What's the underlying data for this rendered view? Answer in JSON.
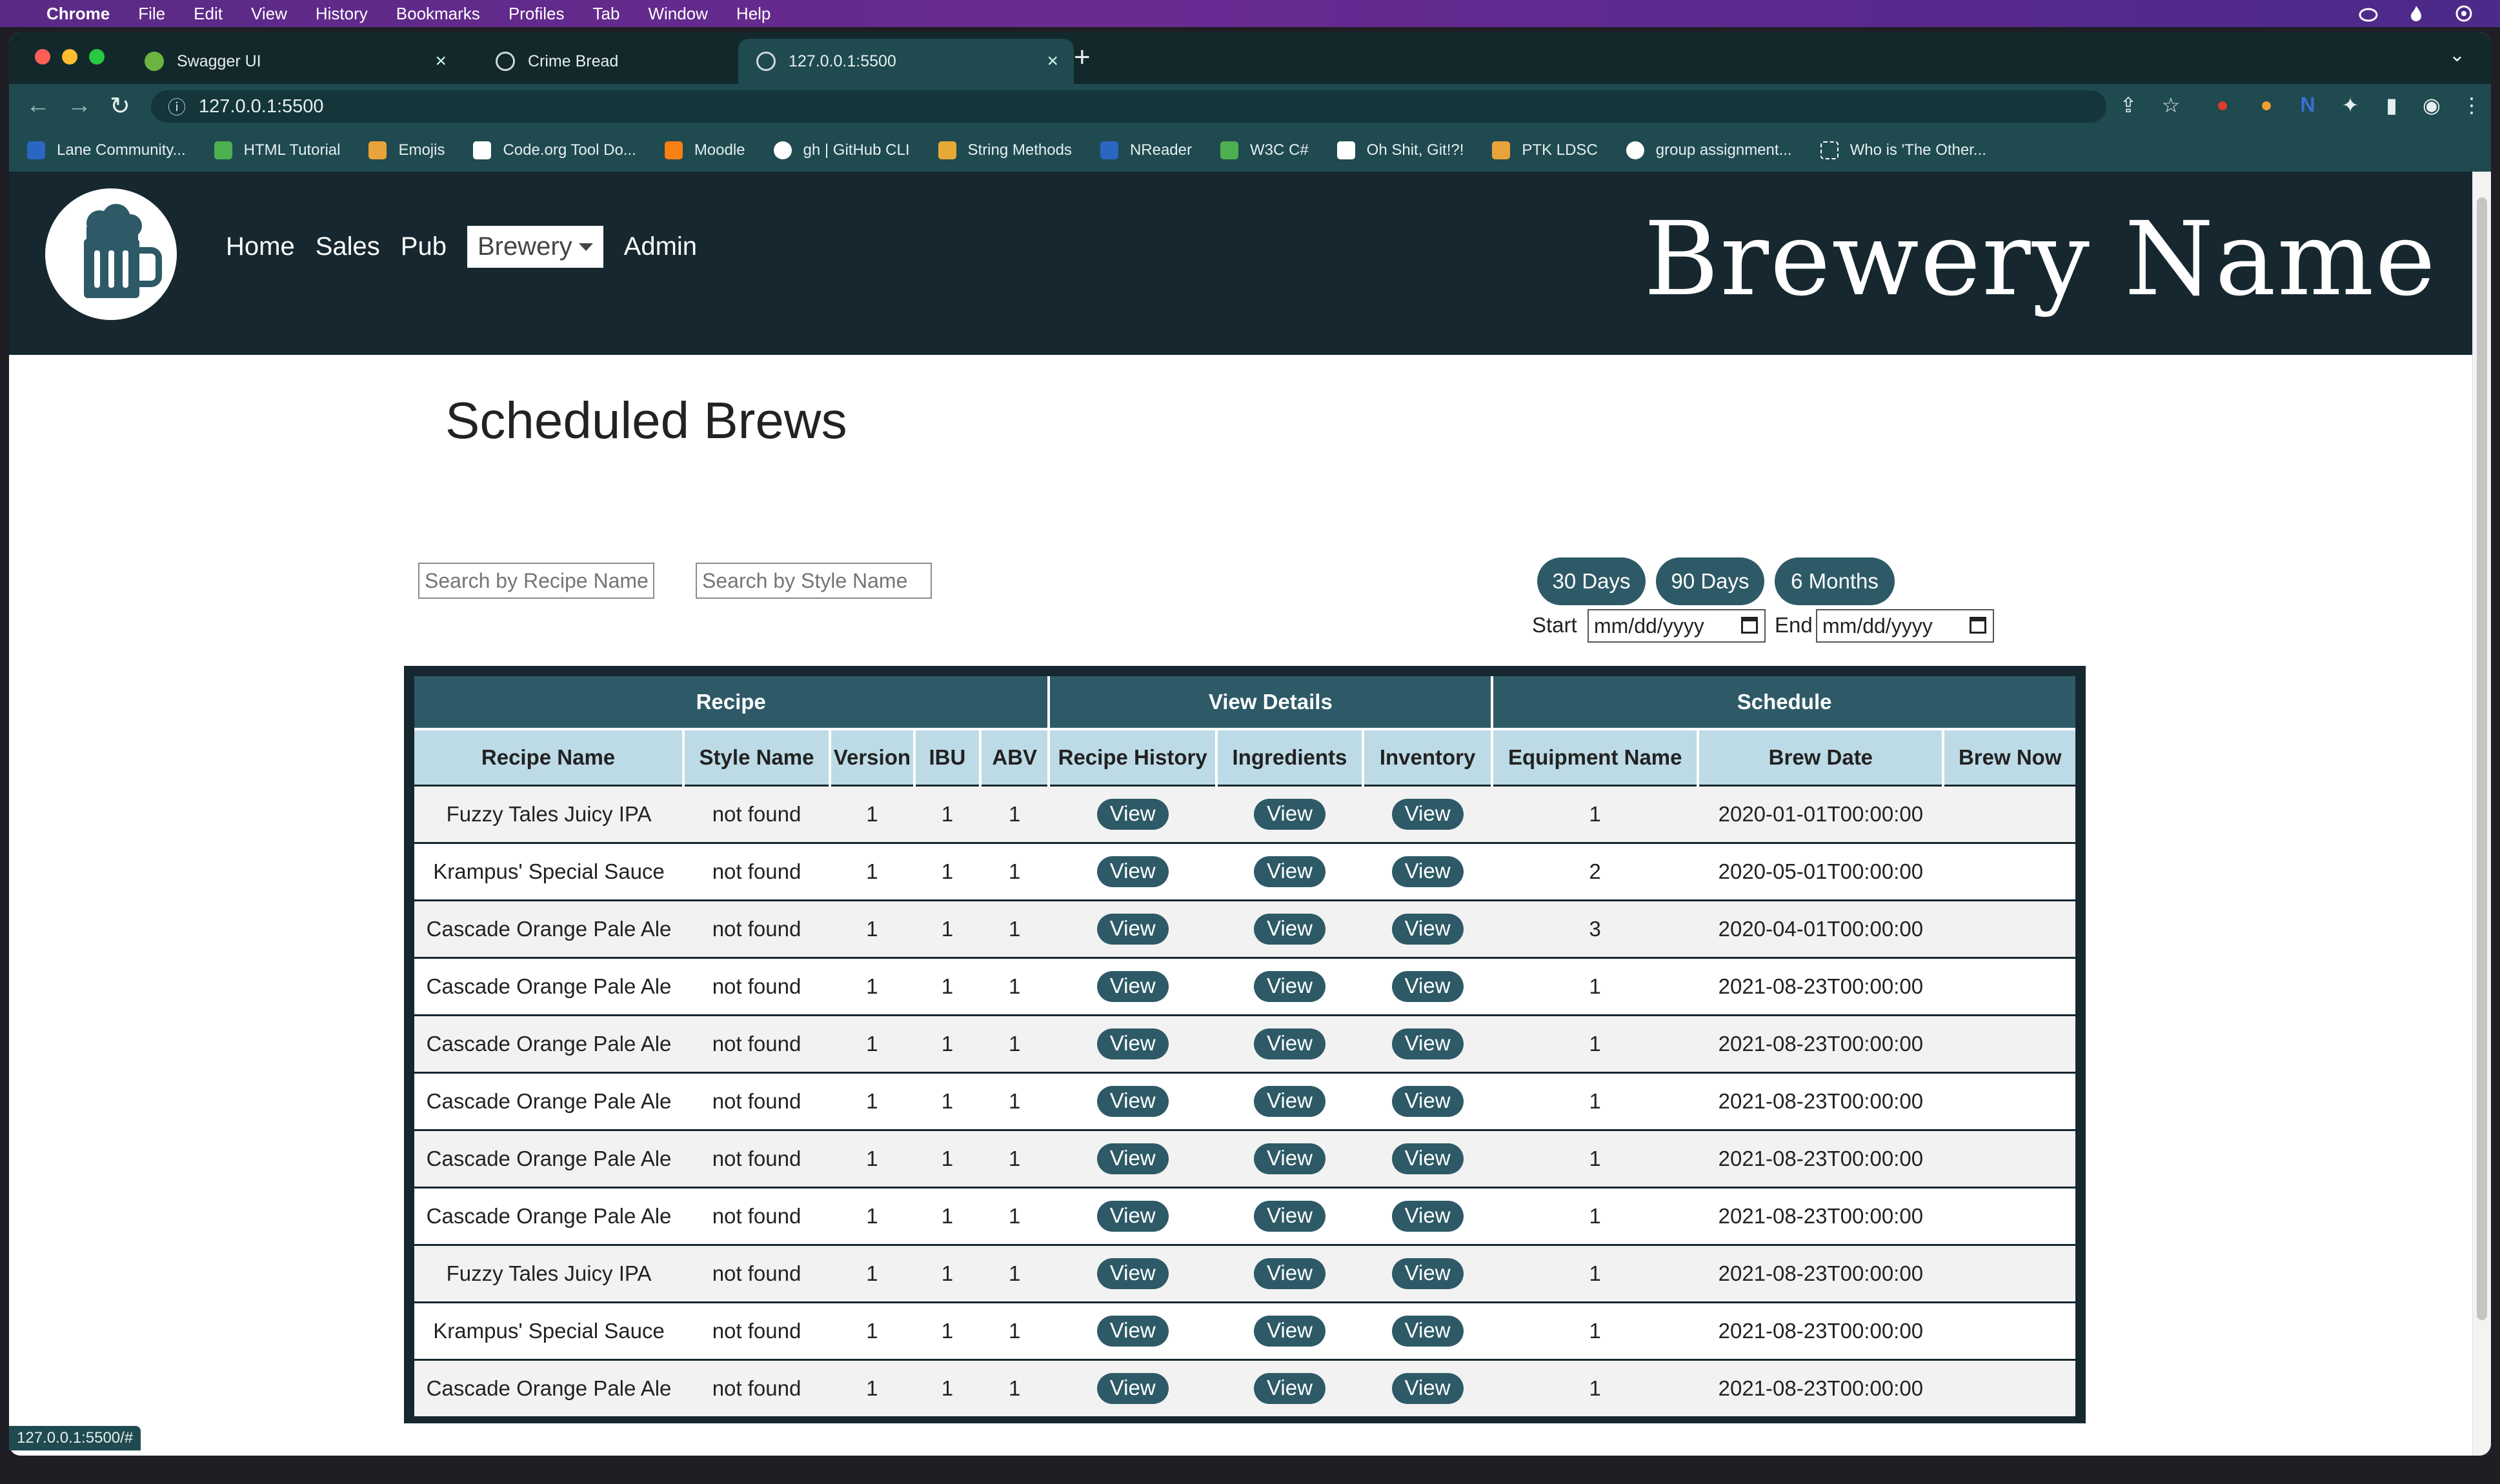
{
  "menubar": {
    "app": "Chrome",
    "items": [
      "File",
      "Edit",
      "View",
      "History",
      "Bookmarks",
      "Profiles",
      "Tab",
      "Window",
      "Help"
    ]
  },
  "tabs": [
    {
      "title": "Swagger UI",
      "icon": "swagger-icon",
      "color": "#6db33f"
    },
    {
      "title": "Crime Bread",
      "icon": "globe-icon",
      "color": "#cfd8da"
    },
    {
      "title": "127.0.0.1:5500",
      "icon": "globe-icon",
      "color": "#cfd8da"
    }
  ],
  "address": {
    "url": "127.0.0.1:5500"
  },
  "bookmarks": [
    {
      "label": "Lane Community...",
      "icon": "shield-icon",
      "color": "#2a66c2"
    },
    {
      "label": "HTML Tutorial",
      "icon": "w3-icon",
      "color": "#4caf50"
    },
    {
      "label": "Emojis",
      "icon": "emoji-icon",
      "color": "#e8a33b"
    },
    {
      "label": "Code.org Tool Do...",
      "icon": "grid-icon",
      "color": "#ffffff"
    },
    {
      "label": "Moodle",
      "icon": "moodle-icon",
      "color": "#f98012"
    },
    {
      "label": "gh | GitHub CLI",
      "icon": "github-icon",
      "color": "#ffffff"
    },
    {
      "label": "String Methods",
      "icon": "grid-icon",
      "color": "#e7a935"
    },
    {
      "label": "NReader",
      "icon": "n-icon",
      "color": "#2a66c2"
    },
    {
      "label": "W3C C#",
      "icon": "w3-icon",
      "color": "#4caf50"
    },
    {
      "label": "Oh Shit, Git!?!",
      "icon": "question-icon",
      "color": "#ffffff"
    },
    {
      "label": "PTK LDSC",
      "icon": "ptk-icon",
      "color": "#e8a33b"
    },
    {
      "label": "group assignment...",
      "icon": "google-icon",
      "color": "#ffffff"
    },
    {
      "label": "Who is 'The Other...",
      "icon": "quote-icon",
      "color": "#ffffff"
    }
  ],
  "site": {
    "nav": [
      "Home",
      "Sales",
      "Pub",
      "Brewery",
      "Admin"
    ],
    "brand": "Brewery Name"
  },
  "page": {
    "title": "Scheduled Brews",
    "search_recipe_placeholder": "Search by Recipe Name",
    "search_style_placeholder": "Search by Style Name",
    "range_buttons": [
      "30 Days",
      "90 Days",
      "6 Months"
    ],
    "start_label": "Start",
    "end_label": "End",
    "date_placeholder": "mm/dd/yyyy"
  },
  "table": {
    "groups": [
      "Recipe",
      "View Details",
      "Schedule"
    ],
    "columns": [
      "Recipe Name",
      "Style Name",
      "Version",
      "IBU",
      "ABV",
      "Recipe History",
      "Ingredients",
      "Inventory",
      "Equipment Name",
      "Brew Date",
      "Brew Now"
    ],
    "view_label": "View",
    "rows": [
      {
        "recipe": "Fuzzy Tales Juicy IPA",
        "style": "not found",
        "version": "1",
        "ibu": "1",
        "abv": "1",
        "equipment": "1",
        "date": "2020-01-01T00:00:00"
      },
      {
        "recipe": "Krampus' Special Sauce",
        "style": "not found",
        "version": "1",
        "ibu": "1",
        "abv": "1",
        "equipment": "2",
        "date": "2020-05-01T00:00:00"
      },
      {
        "recipe": "Cascade Orange Pale Ale",
        "style": "not found",
        "version": "1",
        "ibu": "1",
        "abv": "1",
        "equipment": "3",
        "date": "2020-04-01T00:00:00"
      },
      {
        "recipe": "Cascade Orange Pale Ale",
        "style": "not found",
        "version": "1",
        "ibu": "1",
        "abv": "1",
        "equipment": "1",
        "date": "2021-08-23T00:00:00"
      },
      {
        "recipe": "Cascade Orange Pale Ale",
        "style": "not found",
        "version": "1",
        "ibu": "1",
        "abv": "1",
        "equipment": "1",
        "date": "2021-08-23T00:00:00"
      },
      {
        "recipe": "Cascade Orange Pale Ale",
        "style": "not found",
        "version": "1",
        "ibu": "1",
        "abv": "1",
        "equipment": "1",
        "date": "2021-08-23T00:00:00"
      },
      {
        "recipe": "Cascade Orange Pale Ale",
        "style": "not found",
        "version": "1",
        "ibu": "1",
        "abv": "1",
        "equipment": "1",
        "date": "2021-08-23T00:00:00"
      },
      {
        "recipe": "Cascade Orange Pale Ale",
        "style": "not found",
        "version": "1",
        "ibu": "1",
        "abv": "1",
        "equipment": "1",
        "date": "2021-08-23T00:00:00"
      },
      {
        "recipe": "Fuzzy Tales Juicy IPA",
        "style": "not found",
        "version": "1",
        "ibu": "1",
        "abv": "1",
        "equipment": "1",
        "date": "2021-08-23T00:00:00"
      },
      {
        "recipe": "Krampus' Special Sauce",
        "style": "not found",
        "version": "1",
        "ibu": "1",
        "abv": "1",
        "equipment": "1",
        "date": "2021-08-23T00:00:00"
      },
      {
        "recipe": "Cascade Orange Pale Ale",
        "style": "not found",
        "version": "1",
        "ibu": "1",
        "abv": "1",
        "equipment": "1",
        "date": "2021-08-23T00:00:00"
      }
    ]
  },
  "status_url": "127.0.0.1:5500/#",
  "colors": {
    "nav_bg": "#16272f",
    "accent": "#2d5a66",
    "header_light": "#bddbe6",
    "chrome_toolbar": "#1f4a50"
  }
}
